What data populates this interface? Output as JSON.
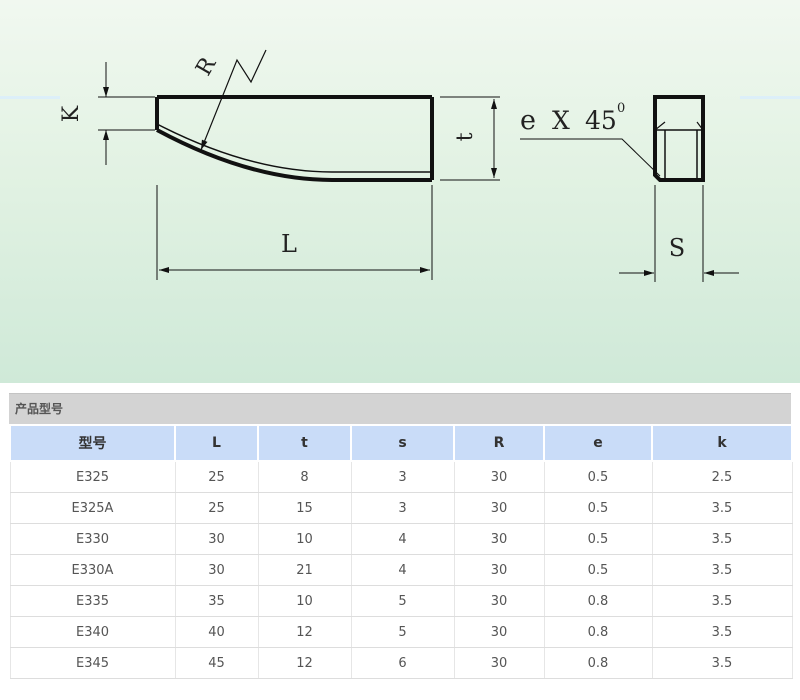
{
  "diagram": {
    "labels": {
      "k": "K",
      "r": "R",
      "t": "t",
      "l": "L",
      "chamfer_e": "e",
      "chamfer_x": "X",
      "chamfer_angle": "45",
      "chamfer_degree": "0",
      "s": "S"
    }
  },
  "section": {
    "title": "产品型号"
  },
  "table": {
    "columns": [
      "型号",
      "L",
      "t",
      "s",
      "R",
      "e",
      "k"
    ],
    "rows": [
      [
        "E325",
        "25",
        "8",
        "3",
        "30",
        "0.5",
        "2.5"
      ],
      [
        "E325A",
        "25",
        "15",
        "3",
        "30",
        "0.5",
        "3.5"
      ],
      [
        "E330",
        "30",
        "10",
        "4",
        "30",
        "0.5",
        "3.5"
      ],
      [
        "E330A",
        "30",
        "21",
        "4",
        "30",
        "0.5",
        "3.5"
      ],
      [
        "E335",
        "35",
        "10",
        "5",
        "30",
        "0.8",
        "3.5"
      ],
      [
        "E340",
        "40",
        "12",
        "5",
        "30",
        "0.8",
        "3.5"
      ],
      [
        "E345",
        "45",
        "12",
        "6",
        "30",
        "0.8",
        "3.5"
      ]
    ]
  },
  "colors": {
    "header_background": "#c9dcf8",
    "section_background": "#d3d3d3"
  }
}
